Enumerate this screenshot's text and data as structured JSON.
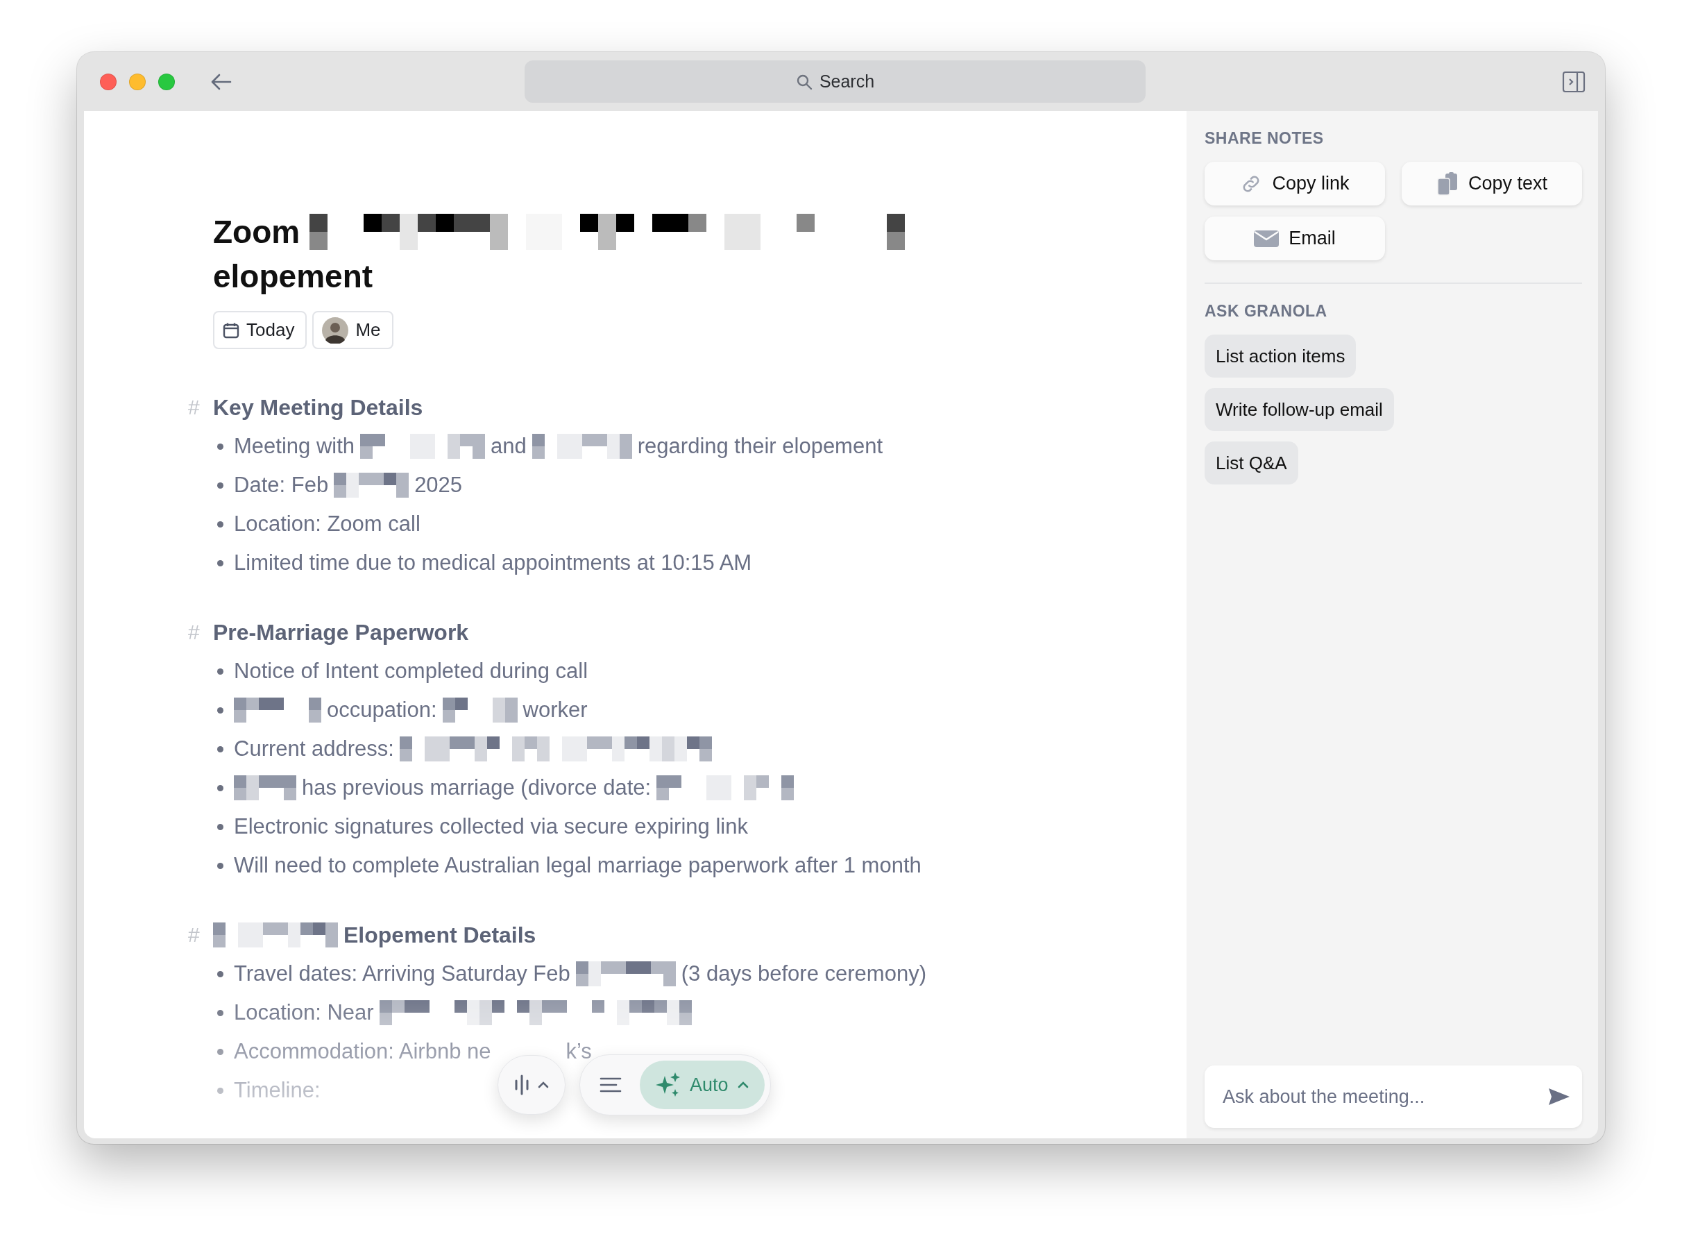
{
  "window": {
    "search": "Search"
  },
  "note": {
    "title": [
      {
        "kind": "text",
        "text": "Zoom"
      },
      {
        "kind": "redacted"
      },
      {
        "kind": "text",
        "text": "elopement"
      }
    ],
    "chips": [
      {
        "kind": "date",
        "label": "Today"
      },
      {
        "kind": "person",
        "label": "Me"
      }
    ],
    "sections": [
      {
        "marker": "#",
        "heading": [
          {
            "kind": "text",
            "text": "Key Meeting Details"
          }
        ],
        "bullets": [
          [
            {
              "kind": "text",
              "text": "Meeting with"
            },
            {
              "kind": "redacted"
            },
            {
              "kind": "text",
              "text": "and"
            },
            {
              "kind": "redacted"
            },
            {
              "kind": "text",
              "text": "regarding their elopement"
            }
          ],
          [
            {
              "kind": "text",
              "text": "Date: Feb"
            },
            {
              "kind": "redacted"
            },
            {
              "kind": "text",
              "text": "2025"
            }
          ],
          [
            {
              "kind": "text",
              "text": "Location: Zoom call"
            }
          ],
          [
            {
              "kind": "text",
              "text": "Limited time due to medical appointments at 10:15 AM"
            }
          ]
        ]
      },
      {
        "marker": "#",
        "heading": [
          {
            "kind": "text",
            "text": "Pre-Marriage Paperwork"
          }
        ],
        "bullets": [
          [
            {
              "kind": "text",
              "text": "Notice of Intent completed during call"
            }
          ],
          [
            {
              "kind": "redacted"
            },
            {
              "kind": "text",
              "text": "occupation:"
            },
            {
              "kind": "redacted"
            },
            {
              "kind": "text",
              "text": "worker"
            }
          ],
          [
            {
              "kind": "text",
              "text": "Current address:"
            },
            {
              "kind": "redacted"
            }
          ],
          [
            {
              "kind": "redacted"
            },
            {
              "kind": "text",
              "text": "has previous marriage (divorce date:"
            },
            {
              "kind": "redacted"
            }
          ],
          [
            {
              "kind": "text",
              "text": "Electronic signatures collected via secure expiring link"
            }
          ],
          [
            {
              "kind": "text",
              "text": "Will need to complete Australian legal marriage paperwork after 1 month"
            }
          ]
        ]
      },
      {
        "marker": "#",
        "heading": [
          {
            "kind": "redacted"
          },
          {
            "kind": "text",
            "text": "Elopement Details"
          }
        ],
        "bullets": [
          [
            {
              "kind": "text",
              "text": "Travel dates: Arriving Saturday Feb"
            },
            {
              "kind": "redacted"
            },
            {
              "kind": "text",
              "text": "(3 days before ceremony)"
            }
          ],
          [
            {
              "kind": "text",
              "text": "Location: Near"
            },
            {
              "kind": "redacted"
            }
          ],
          [
            {
              "kind": "text",
              "text": "Accommodation: Airbnb ne"
            },
            {
              "kind": "covered"
            },
            {
              "kind": "text",
              "text": "k’s"
            }
          ],
          [
            {
              "kind": "text",
              "text": "Timeline:"
            }
          ]
        ]
      }
    ]
  },
  "sidebar": {
    "share": {
      "title": "SHARE NOTES",
      "buttons": [
        {
          "kind": "link",
          "label": "Copy link"
        },
        {
          "kind": "copy",
          "label": "Copy text"
        },
        {
          "kind": "email",
          "label": "Email"
        }
      ]
    },
    "ask": {
      "title": "ASK GRANOLA",
      "prompts": [
        "List action items",
        "Write follow-up email",
        "List Q&A"
      ]
    },
    "input": {
      "placeholder": "Ask about the meeting..."
    }
  },
  "toolbar": {
    "mode": "Auto"
  }
}
